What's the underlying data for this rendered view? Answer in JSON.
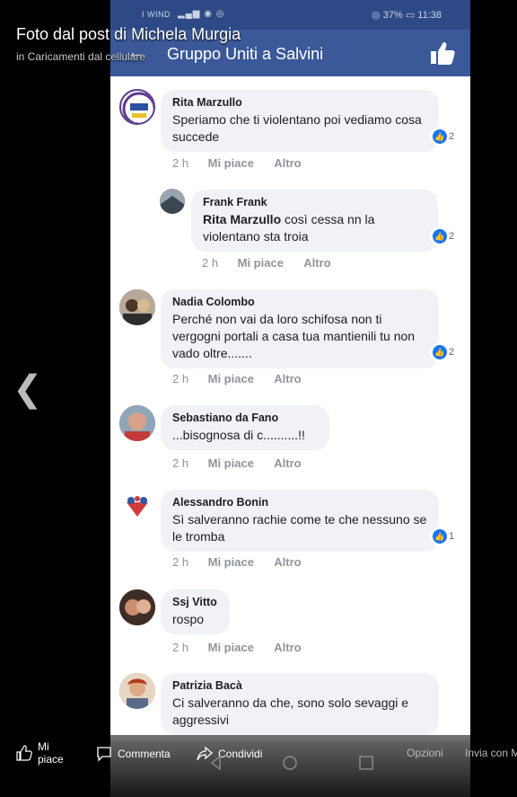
{
  "viewer": {
    "post_title": "Foto dal post di Michela Murgia",
    "post_subtitle": "in Caricamenti dal cellulare"
  },
  "phone": {
    "carrier": "I WIND",
    "battery": "37%",
    "time": "11:38",
    "group_title": "Gruppo Uniti a Salvini"
  },
  "comments": [
    {
      "author": "Rita Marzullo",
      "text": "Speriamo che ti violentano poi vediamo cosa succede",
      "reactions": "2",
      "time": "2 h",
      "like": "Mi piace",
      "more": "Altro"
    },
    {
      "author": "Frank Frank",
      "mention": "Rita Marzullo",
      "text": " così cessa nn la violentano sta troia",
      "reactions": "2",
      "time": "2 h",
      "like": "Mi piace",
      "more": "Altro"
    },
    {
      "author": "Nadia Colombo",
      "text": "Perché non vai da loro schifosa non ti vergogni portali a casa tua mantienili tu non vado oltre.......",
      "reactions": "2",
      "time": "2 h",
      "like": "Mi piace",
      "more": "Altro"
    },
    {
      "author": "Sebastiano da Fano",
      "text": "...bisognosa di c..........!!",
      "time": "2 h",
      "like": "Mi piace",
      "more": "Altro"
    },
    {
      "author": "Alessandro Bonin",
      "text": "Sì salveranno rachie come te che nessuno se le tromba",
      "reactions": "1",
      "time": "2 h",
      "like": "Mi piace",
      "more": "Altro"
    },
    {
      "author": "Ssj Vitto",
      "text": "rospo",
      "time": "2 h",
      "like": "Mi piace",
      "more": "Altro"
    },
    {
      "author": "Patrizia Bacà",
      "text": "Ci salveranno da che, sono solo sevaggi e aggressivi"
    }
  ],
  "bottom_bar": {
    "like": "Mi piace",
    "comment": "Commenta",
    "share": "Condividi",
    "options": "Opzioni",
    "send": "Invia con M"
  },
  "colors": {
    "facebook_blue": "#3b5998",
    "status_bar": "#2e4a86",
    "reaction_blue": "#1877f2",
    "bubble": "#f0f2f5"
  }
}
